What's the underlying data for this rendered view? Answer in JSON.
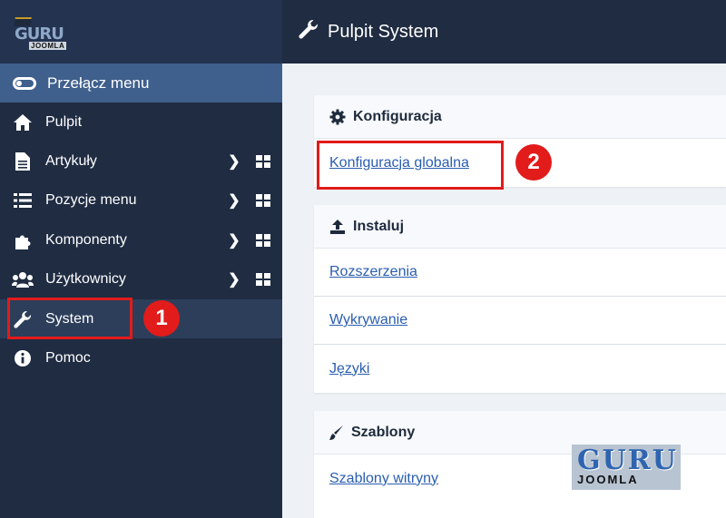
{
  "sidebar": {
    "logo": {
      "line1": "GURU",
      "line2": "JOOMLA"
    },
    "toggle_label": "Przełącz menu",
    "items": [
      {
        "label": "Pulpit"
      },
      {
        "label": "Artykuły"
      },
      {
        "label": "Pozycje menu"
      },
      {
        "label": "Komponenty"
      },
      {
        "label": "Użytkownicy"
      },
      {
        "label": "System"
      },
      {
        "label": "Pomoc"
      }
    ]
  },
  "header": {
    "title": "Pulpit System"
  },
  "cards": {
    "konfiguracja": {
      "title": "Konfiguracja",
      "links": [
        "Konfiguracja globalna"
      ]
    },
    "instaluj": {
      "title": "Instaluj",
      "links": [
        "Rozszerzenia",
        "Wykrywanie",
        "Języki"
      ]
    },
    "szablony": {
      "title": "Szablony",
      "links": [
        "Szablony witryny"
      ]
    }
  },
  "annotations": {
    "badge1": "1",
    "badge2": "2"
  },
  "watermark": {
    "line1": "GURU",
    "line2": "JOOMLA"
  },
  "colors": {
    "sidebar": "#1f2c42",
    "toggle": "#3f5f8c",
    "highlight": "#e21b1b",
    "link": "#2a5db0"
  }
}
